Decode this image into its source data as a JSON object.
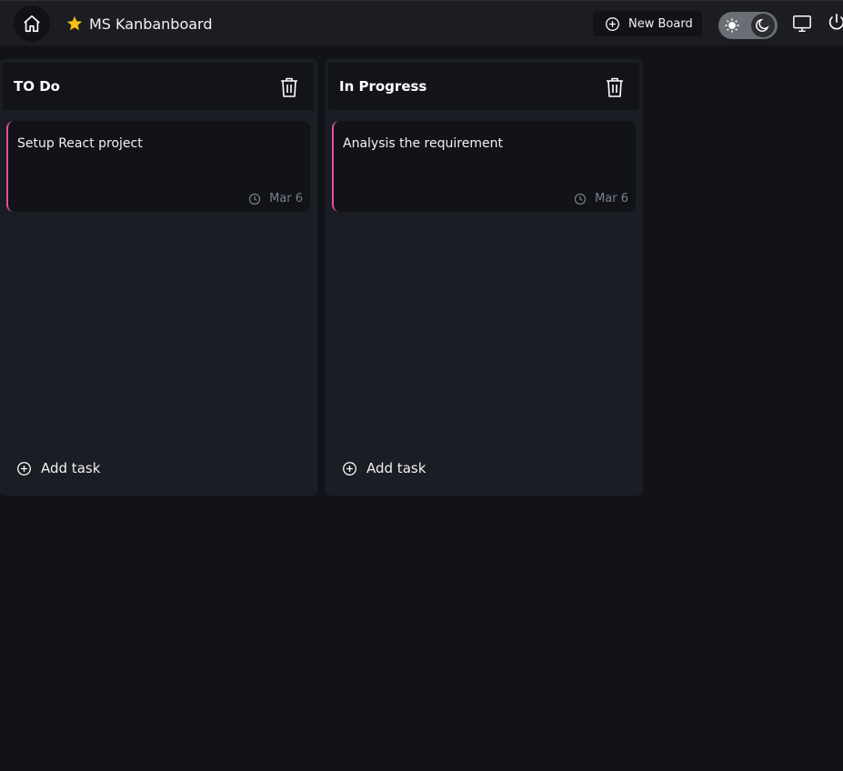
{
  "header": {
    "board_name": "MS Kanbanboard",
    "new_board_label": "New Board",
    "icons": {
      "home": "home-icon",
      "star": "star-icon",
      "new_board": "plus-circle-icon",
      "sun": "sun-icon",
      "moon": "moon-icon",
      "monitor": "monitor-icon",
      "power": "power-icon"
    },
    "star_color": "#f7c31e",
    "theme": "dark"
  },
  "columns": [
    {
      "title": "TO Do",
      "cards": [
        {
          "text": "Setup React project",
          "date": "Mar 6",
          "accent": "#e4509c"
        }
      ],
      "add_task_label": "Add task"
    },
    {
      "title": "In Progress",
      "cards": [
        {
          "text": "Analysis the requirement",
          "date": "Mar 6",
          "accent": "#e4509c"
        }
      ],
      "add_task_label": "Add task"
    }
  ]
}
